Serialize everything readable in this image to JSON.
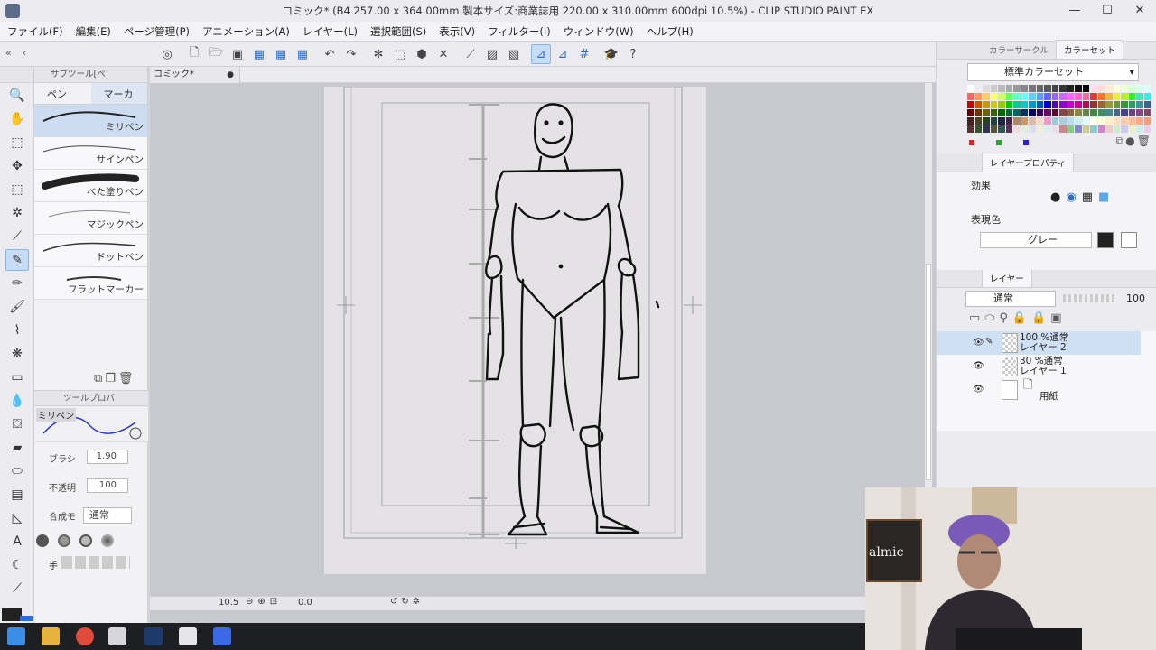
{
  "window": {
    "title": "コミック* (B4 257.00 x 364.00mm 製本サイズ:商業誌用 220.00 x 310.00mm 600dpi 10.5%) - CLIP STUDIO PAINT EX",
    "min": "—",
    "max": "☐",
    "close": "✕"
  },
  "menu": [
    "ファイル(F)",
    "編集(E)",
    "ページ管理(P)",
    "アニメーション(A)",
    "レイヤー(L)",
    "選択範囲(S)",
    "表示(V)",
    "フィルター(I)",
    "ウィンドウ(W)",
    "ヘルプ(H)"
  ],
  "subtool_panel": {
    "header": "サブツール[ペ",
    "tabs": [
      "ペン",
      "マーカ"
    ],
    "brushes": [
      "ミリペン",
      "サインペン",
      "べた塗りペン",
      "マジックペン",
      "ドットペン",
      "フラットマーカー"
    ]
  },
  "tool_property": {
    "header": "ツールプロパ",
    "preset_name": "ミリペン",
    "brush_size_label": "ブラシ",
    "brush_size_value": "1.90",
    "opacity_label": "不透明",
    "opacity_value": "100",
    "blend_label": "合成モ",
    "blend_value": "通常",
    "hand_label": "手"
  },
  "canvas": {
    "tab": "コミック*",
    "zoom": "10.5",
    "rotation": "0.0"
  },
  "color_panel": {
    "tabs": [
      "カラーサークル",
      "カラーセット"
    ],
    "set_name": "標準カラーセット"
  },
  "layer_property": {
    "tab": "レイヤープロパティ",
    "effect_label": "効果",
    "express_color_label": "表現色",
    "express_color_value": "グレー"
  },
  "layer_panel": {
    "tab": "レイヤー",
    "blend_mode": "通常",
    "opacity": "100",
    "layers": [
      {
        "line1": "100 %通常",
        "line2": "レイヤー 2"
      },
      {
        "line1": "30 %通常",
        "line2": "レイヤー 1"
      },
      {
        "line1": "",
        "line2": "用紙"
      }
    ]
  },
  "webcam": {
    "sign": "almic"
  },
  "colors": {
    "accent": "#2a6fd8",
    "selected": "#cfe0f4"
  }
}
